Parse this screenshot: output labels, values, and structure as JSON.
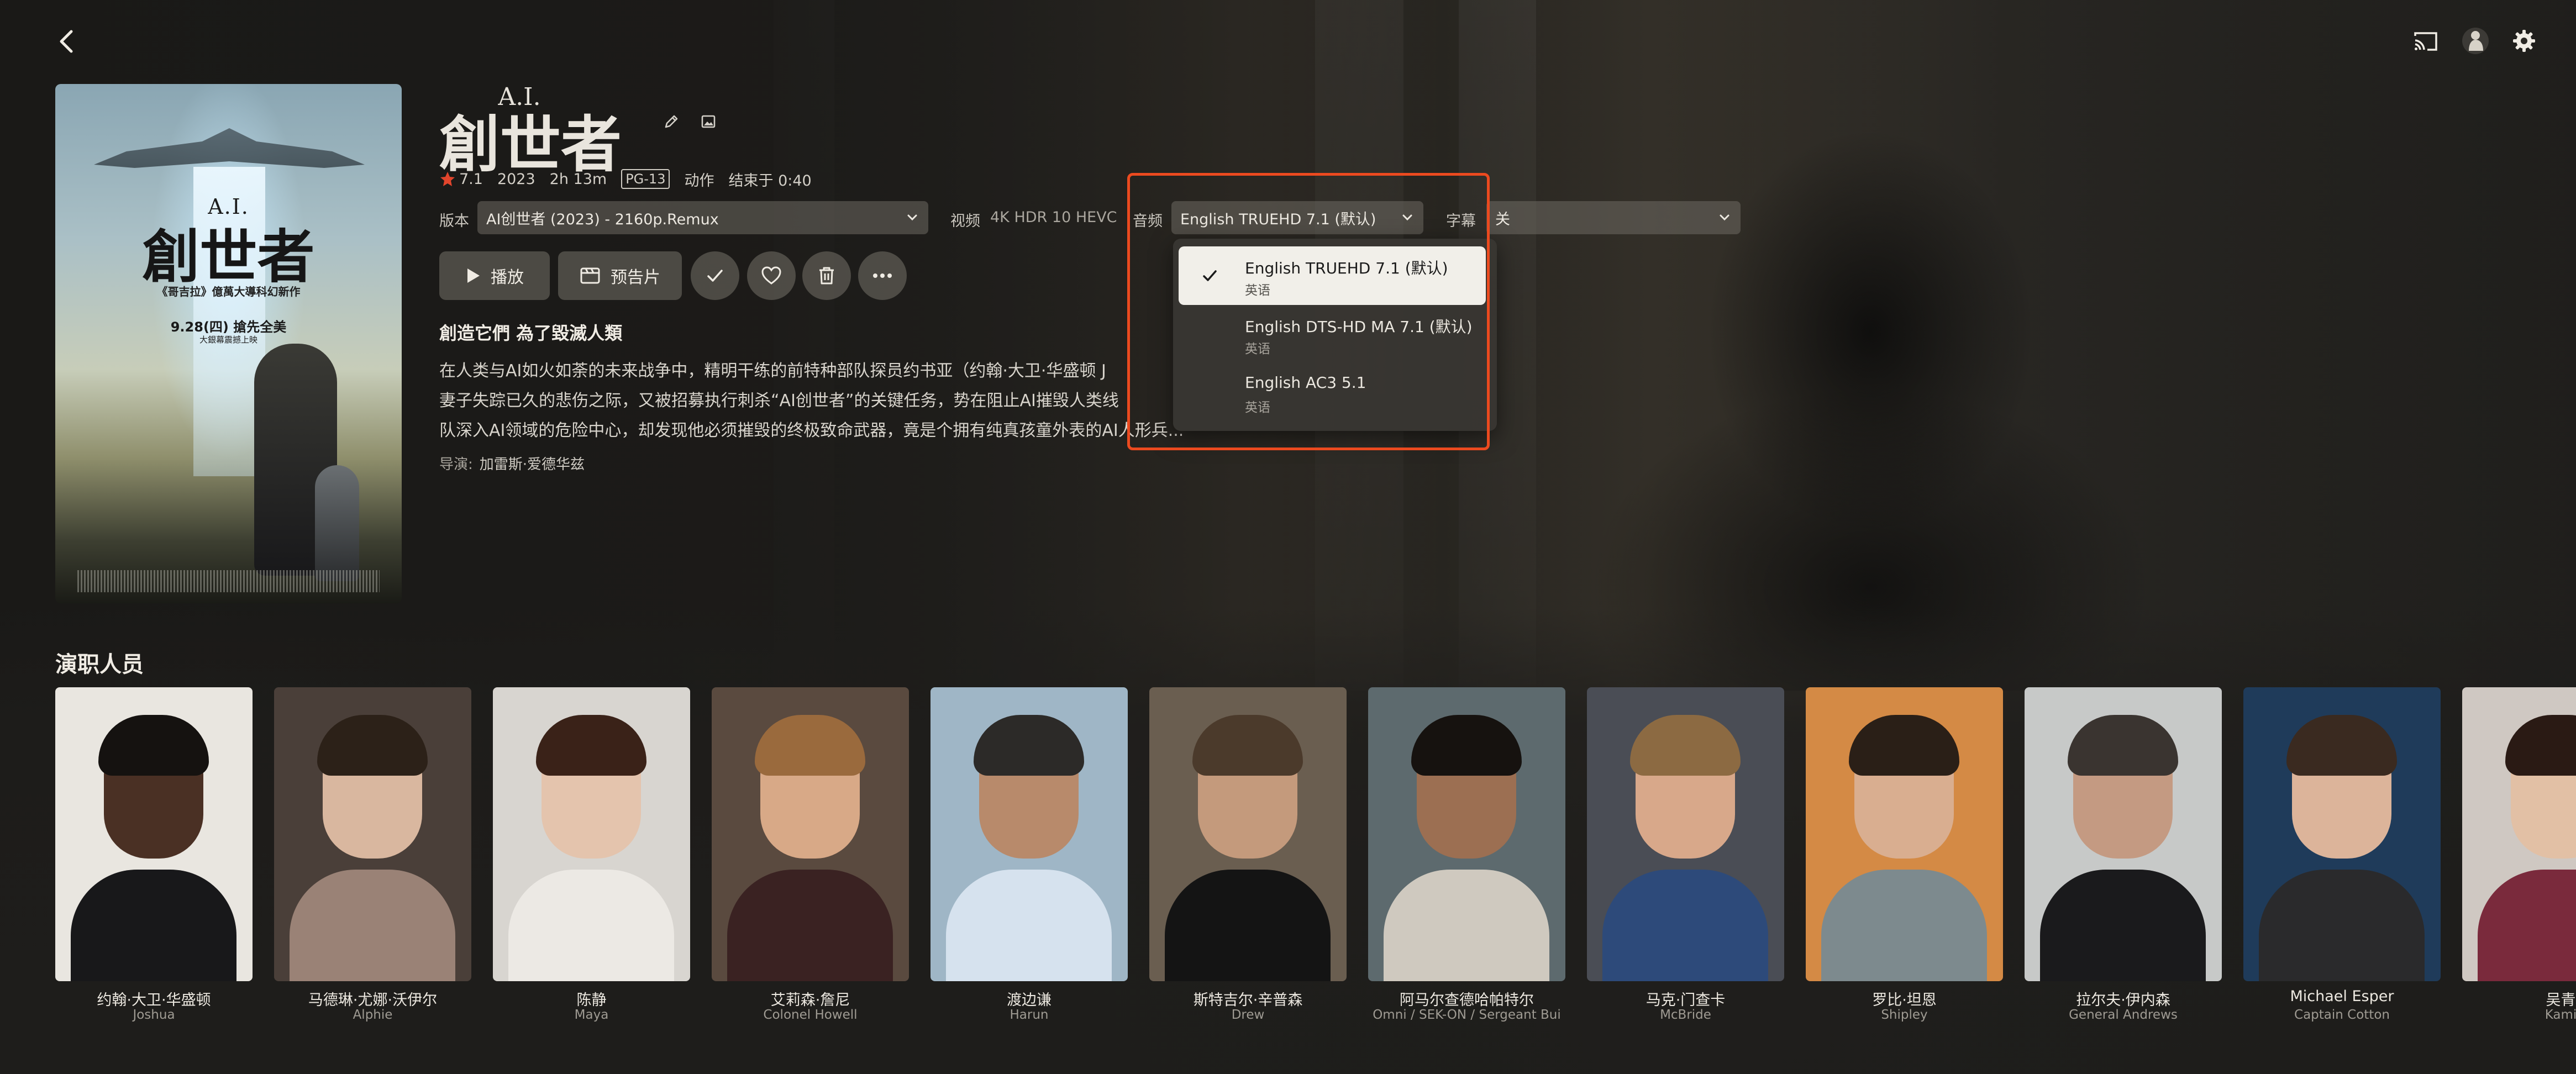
{
  "movie": {
    "title_small": "A.I.",
    "title_main": "創世者",
    "rating": "7.1",
    "year": "2023",
    "runtime": "2h 13m",
    "content_rating": "PG-13",
    "genre": "动作",
    "ends_at": "结束于 0:40",
    "tagline": "創造它們 為了毀滅人類",
    "overview_lines": [
      "在人类与AI如火如荼的未来战争中，精明干练的前特种部队探员约书亚（约翰·大卫·华盛顿 J",
      "妻子失踪已久的悲伤之际，又被招募执行刺杀“AI创世者”的关键任务，势在阻止AI摧毁人类线",
      "队深入AI领域的危险中心，却发现他必须摧毁的终极致命武器，竟是个拥有纯真孩童外表的AI人形兵......"
    ],
    "director_label": "导演:",
    "director": "加雷斯·爱德华兹",
    "poster": {
      "title_small": "A.I.",
      "title": "創世者",
      "tagline": "《哥吉拉》億萬大導科幻新作",
      "date": "9.28(四) 搶先全美",
      "date_sub": "大銀幕震撼上映"
    }
  },
  "selectors": {
    "version_label": "版本",
    "version_value": "AI创世者 (2023) - 2160p.Remux",
    "video_label": "视频",
    "video_value": "4K HDR 10 HEVC",
    "audio_label": "音频",
    "audio_value": "English TRUEHD 7.1 (默认)",
    "subtitle_label": "字幕",
    "subtitle_value": "关"
  },
  "actions": {
    "play": "播放",
    "trailer": "预告片"
  },
  "audio_menu": {
    "options": [
      {
        "title": "English TRUEHD 7.1 (默认)",
        "sub": "英语",
        "selected": true
      },
      {
        "title": "English DTS-HD MA 7.1 (默认)",
        "sub": "英语",
        "selected": false
      },
      {
        "title": "English AC3 5.1",
        "sub": "英语",
        "selected": false
      }
    ]
  },
  "cast": {
    "heading": "演职人员",
    "members": [
      {
        "name": "约翰·大卫·华盛顿",
        "role": "Joshua",
        "bg": "#e9e6e0",
        "skin": "#4a3024",
        "hair": "#151210",
        "cloth": "#18181a"
      },
      {
        "name": "马德琳·尤娜·沃伊尔",
        "role": "Alphie",
        "bg": "#4a3f39",
        "skin": "#d9b79f",
        "hair": "#2c2118",
        "cloth": "#9a8276"
      },
      {
        "name": "陈静",
        "role": "Maya",
        "bg": "#d8d5d0",
        "skin": "#e4c4ad",
        "hair": "#3a2218",
        "cloth": "#ece9e4"
      },
      {
        "name": "艾莉森·詹尼",
        "role": "Colonel Howell",
        "bg": "#5a4a3f",
        "skin": "#d8a987",
        "hair": "#9a6a3d",
        "cloth": "#3a2222"
      },
      {
        "name": "渡边谦",
        "role": "Harun",
        "bg": "#9fb6c6",
        "skin": "#b88a6b",
        "hair": "#2c2a28",
        "cloth": "#d6e2ee"
      },
      {
        "name": "斯特吉尔·辛普森",
        "role": "Drew",
        "bg": "#6a5e50",
        "skin": "#c49a7c",
        "hair": "#4b3a2b",
        "cloth": "#141414"
      },
      {
        "name": "阿马尔查德哈帕特尔",
        "role": "Omni / SEK-ON / Sergeant Bui",
        "bg": "#5d6a6e",
        "skin": "#9c6f52",
        "hair": "#16120f",
        "cloth": "#cfc9bf"
      },
      {
        "name": "马克·门查卡",
        "role": "McBride",
        "bg": "#4a4d55",
        "skin": "#d8a88a",
        "hair": "#8c6a42",
        "cloth": "#2d4a7a"
      },
      {
        "name": "罗比·坦恩",
        "role": "Shipley",
        "bg": "#d48a45",
        "skin": "#d9ae90",
        "hair": "#2a1f17",
        "cloth": "#7d8a8e"
      },
      {
        "name": "拉尔夫·伊内森",
        "role": "General Andrews",
        "bg": "#c7c9c8",
        "skin": "#c49a82",
        "hair": "#3a3430",
        "cloth": "#1a1a1c"
      },
      {
        "name": "Michael Esper",
        "role": "Captain Cotton",
        "bg": "#1f3b5a",
        "skin": "#dcb49a",
        "hair": "#3a2a20",
        "cloth": "#2a2a2c"
      },
      {
        "name": "吴青",
        "role": "Kami",
        "bg": "#cfc8c2",
        "skin": "#e2c0a5",
        "hair": "#2a1a14",
        "cloth": "#7a2a3c"
      }
    ]
  }
}
